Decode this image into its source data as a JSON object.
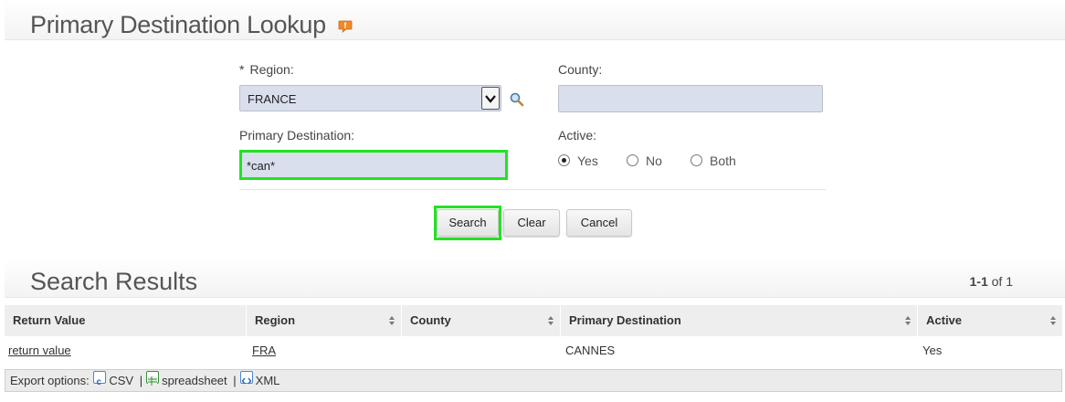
{
  "lookup": {
    "title": "Primary Destination Lookup",
    "region_required_marker": "*",
    "region_label": "Region:",
    "region_value": "FRANCE",
    "county_label": "County:",
    "county_value": "",
    "primary_destination_label": "Primary Destination:",
    "primary_destination_value": "*can*",
    "active_label": "Active:",
    "active_options": [
      "Yes",
      "No",
      "Both"
    ],
    "active_selected": "Yes",
    "buttons": {
      "search": "Search",
      "clear": "Clear",
      "cancel": "Cancel"
    }
  },
  "results": {
    "title": "Search Results",
    "count_range": "1-1",
    "count_of": "of 1",
    "columns": [
      "Return Value",
      "Region",
      "County",
      "Primary Destination",
      "Active"
    ],
    "rows": [
      {
        "return_value": "return value",
        "region": "FRA",
        "county": "",
        "primary_destination": "CANNES",
        "active": "Yes"
      }
    ],
    "export": {
      "label": "Export options:",
      "csv": "CSV",
      "spreadsheet": "spreadsheet",
      "xml": "XML"
    }
  },
  "colors": {
    "highlight": "#22e322",
    "input_bg": "#d9dfec"
  }
}
